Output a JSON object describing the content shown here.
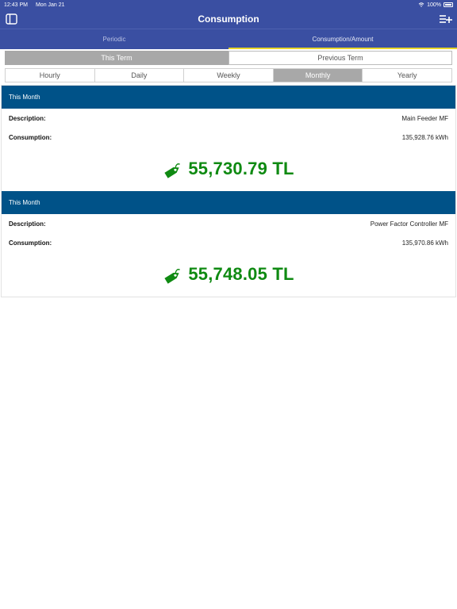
{
  "status": {
    "time": "12:43 PM",
    "date": "Mon Jan 21",
    "battery": "100%"
  },
  "nav": {
    "title": "Consumption",
    "left_icon": "sidebar-icon",
    "right_icon": "list-add-icon"
  },
  "tabs": [
    {
      "label": "Periodic",
      "active": false
    },
    {
      "label": "Consumption/Amount",
      "active": true
    }
  ],
  "terms": [
    {
      "label": "This Term",
      "selected": true
    },
    {
      "label": "Previous Term",
      "selected": false
    }
  ],
  "periods": [
    {
      "label": "Hourly",
      "selected": false
    },
    {
      "label": "Daily",
      "selected": false
    },
    {
      "label": "Weekly",
      "selected": false
    },
    {
      "label": "Monthly",
      "selected": true
    },
    {
      "label": "Yearly",
      "selected": false
    }
  ],
  "cards": [
    {
      "header": "This Month",
      "description_label": "Description:",
      "description": "Main Feeder MF",
      "consumption_label": "Consumption:",
      "consumption": "135,928.76 kWh",
      "amount": "55,730.79 TL"
    },
    {
      "header": "This Month",
      "description_label": "Description:",
      "description": "Power Factor Controller MF",
      "consumption_label": "Consumption:",
      "consumption": "135,970.86 kWh",
      "amount": "55,748.05 TL"
    }
  ],
  "colors": {
    "primary": "#3a4fa2",
    "card_header": "#005288",
    "amount": "#0f8a12",
    "tab_indicator": "#e8d62a",
    "selected_segment": "#a8a8a8"
  }
}
